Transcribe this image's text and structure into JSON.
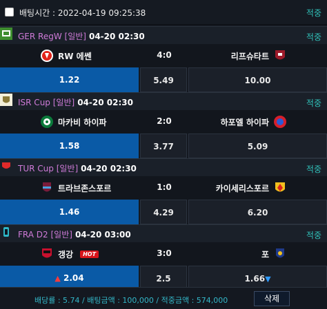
{
  "header": {
    "bet_time": "배팅시간 : 2022-04-19 09:25:38",
    "status": "적중"
  },
  "matches": [
    {
      "league": "GER RegW",
      "type": "[일반]",
      "time": "04-20 02:30",
      "status": "적중",
      "home": "RW 에쎈",
      "score": "4:0",
      "away": "리프슈타트",
      "odd_home": "1.22",
      "odd_draw": "5.49",
      "odd_away": "10.00"
    },
    {
      "league": "ISR Cup",
      "type": "[일반]",
      "time": "04-20 02:30",
      "status": "적중",
      "home": "마카비 하이파",
      "score": "2:0",
      "away": "하포엘 하이파",
      "odd_home": "1.58",
      "odd_draw": "3.77",
      "odd_away": "5.09"
    },
    {
      "league": "TUR Cup",
      "type": "[일반]",
      "time": "04-20 02:30",
      "status": "적중",
      "home": "트라브존스포르",
      "score": "1:0",
      "away": "카이세리스포르",
      "odd_home": "1.46",
      "odd_draw": "4.29",
      "odd_away": "6.20"
    },
    {
      "league": "FRA D2",
      "type": "[일반]",
      "time": "04-20 03:00",
      "status": "적중",
      "home": "갱강",
      "hot_badge": "HOT",
      "score": "3:0",
      "away": "포",
      "odd_home": "2.04",
      "odd_draw": "2.5",
      "odd_away": "1.66"
    }
  ],
  "footer": {
    "summary": "배당률 : 5.74 / 배팅금액 : 100,000 / 적중금액 : 574,000",
    "delete_label": "삭제"
  },
  "colors": {
    "accent_blue": "#0a5aa6",
    "hit_teal": "#30c0b8",
    "league_pink": "#d07bd9"
  }
}
